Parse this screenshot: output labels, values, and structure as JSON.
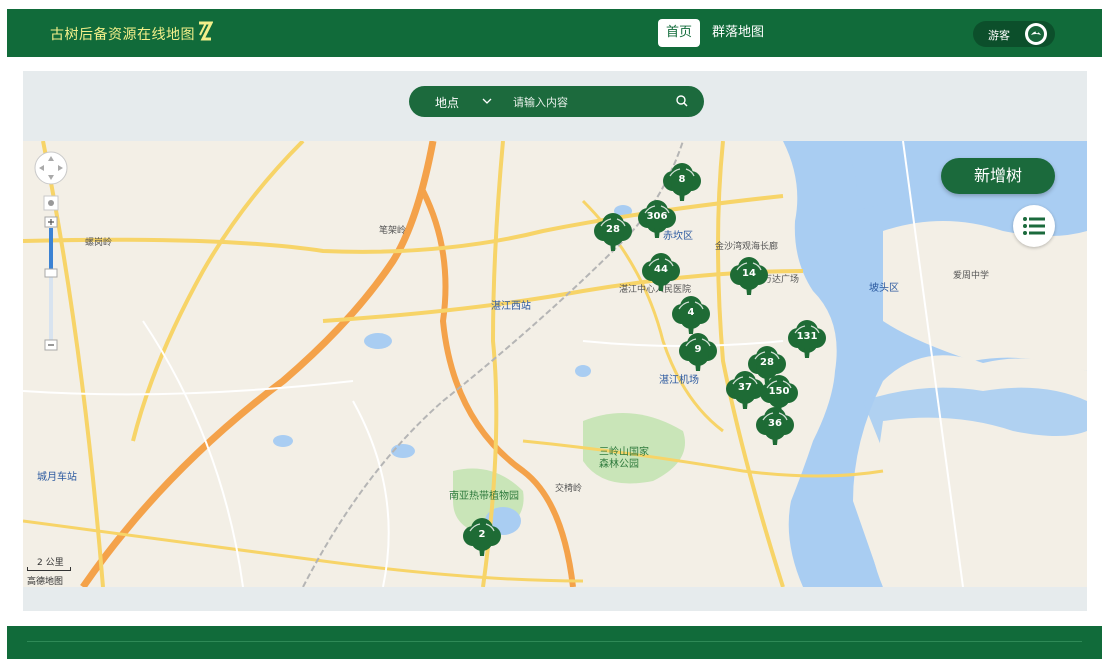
{
  "header": {
    "site_title": "古树后备资源在线地图",
    "nav_tabs": [
      {
        "label": "首页",
        "active": true
      },
      {
        "label": "群落地图",
        "active": false
      }
    ],
    "user_label": "游客"
  },
  "search": {
    "type_label": "地点",
    "placeholder": "请输入内容"
  },
  "map": {
    "add_tree_label": "新增树",
    "scale_label": "2 公里",
    "provider_label": "高德地图",
    "place_labels": {
      "zhanjiang_west": "湛江西站",
      "airport": "湛江机场",
      "hospital": "湛江中心人民医院",
      "botanic": "南亚热带植物园",
      "forest_park": "三岭山国家森林公园",
      "jinsha": "金沙湾观海长廊",
      "wanda": "万达广场",
      "chikan": "赤坎区",
      "kengtou": "坡头区",
      "aizhou": "爱周中学",
      "chengyue": "城月车站",
      "luogang": "螺岗岭",
      "bijia": "笔架岭",
      "jiaoyi": "交椅岭"
    },
    "clusters": [
      {
        "count": "8"
      },
      {
        "count": "306"
      },
      {
        "count": "28"
      },
      {
        "count": "44"
      },
      {
        "count": "14"
      },
      {
        "count": "4"
      },
      {
        "count": "9"
      },
      {
        "count": "131"
      },
      {
        "count": "28"
      },
      {
        "count": "37"
      },
      {
        "count": "150"
      },
      {
        "count": "36"
      },
      {
        "count": "2"
      }
    ]
  },
  "colors": {
    "brand_green": "#116b3a",
    "title_yellow": "#f2ef8a",
    "cluster_green": "#1e6b35",
    "water": "#a9cdf2",
    "road_orange": "#f4a24a",
    "road_yellow": "#f7d468"
  }
}
